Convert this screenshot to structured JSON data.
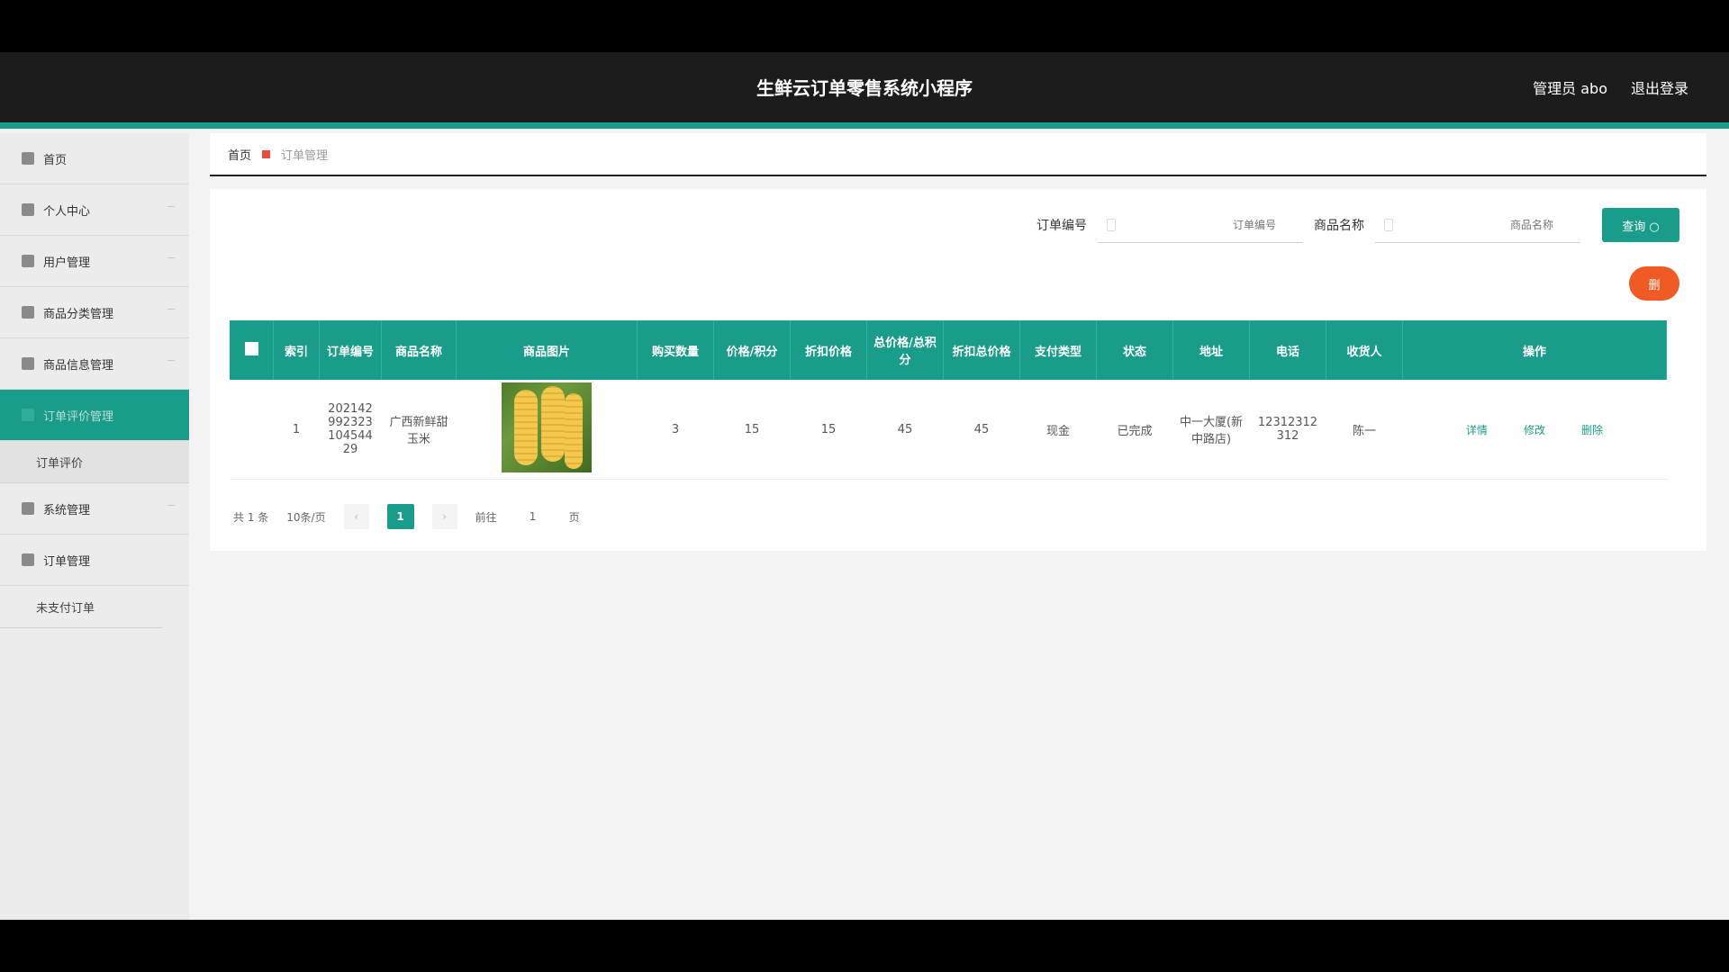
{
  "header": {
    "title": "生鲜云订单零售系统小程序",
    "admin": "管理员 abo",
    "logout": "退出登录"
  },
  "sidebar": {
    "items": [
      {
        "label": "首页",
        "icon": "home-icon"
      },
      {
        "label": "个人中心",
        "icon": "user-icon"
      },
      {
        "label": "用户管理",
        "icon": "users-icon"
      },
      {
        "label": "商品分类管理",
        "icon": "grid-icon"
      },
      {
        "label": "商品信息管理",
        "icon": "shop-icon"
      },
      {
        "label": "订单评价管理",
        "icon": "order-icon"
      }
    ],
    "sub_active": "订单评价",
    "items2": [
      {
        "label": "系统管理",
        "icon": "settings-icon"
      },
      {
        "label": "订单管理",
        "icon": "list-icon"
      }
    ],
    "sub2": "未支付订单"
  },
  "breadcrumb": {
    "home": "首页",
    "current": "订单管理"
  },
  "search": {
    "order_label": "订单编号",
    "order_placeholder": "订单编号",
    "product_label": "商品名称",
    "product_placeholder": "商品名称",
    "query_label": "查询 ○"
  },
  "delete_btn": "删",
  "table": {
    "headers": [
      "索引",
      "订单编号",
      "商品名称",
      "商品图片",
      "购买数量",
      "价格/积分",
      "折扣价格",
      "总价格/总积分",
      "折扣总价格",
      "支付类型",
      "状态",
      "地址",
      "电话",
      "收货人",
      "操作"
    ],
    "rows": [
      {
        "index": "1",
        "order_no": "20214299232310454429",
        "product": "广西新鲜甜玉米",
        "image": "corn-image",
        "qty": "3",
        "price": "15",
        "discount_price": "15",
        "total": "45",
        "discount_total": "45",
        "pay_type": "现金",
        "status": "已完成",
        "address": "中一大厦(新中路店)",
        "phone": "12312312312",
        "receiver": "陈一",
        "ops": {
          "detail": "详情",
          "edit": "修改",
          "delete": "删除"
        }
      }
    ]
  },
  "pager": {
    "total": "共 1 条",
    "page_size": "10条/页",
    "current": "1",
    "goto": "前往",
    "goto_value": "1",
    "page_suffix": "页"
  }
}
